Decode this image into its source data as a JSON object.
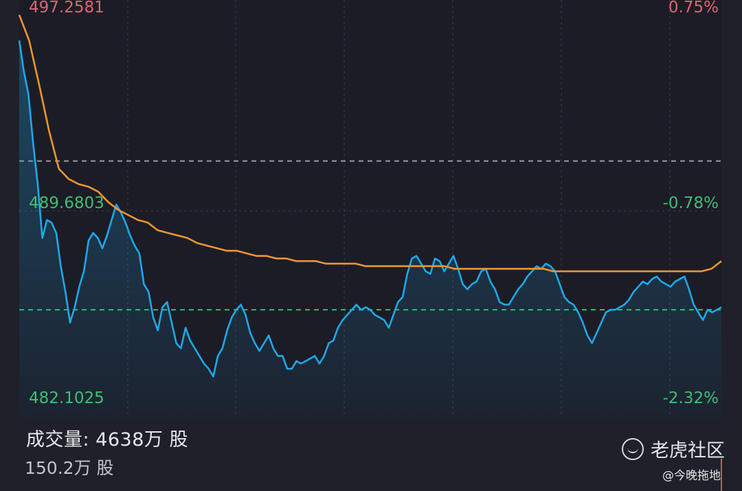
{
  "chart_data": {
    "type": "line",
    "ylim": [
      482.1025,
      497.2581
    ],
    "y_ticks_left": [
      "497.2581",
      "489.6803",
      "482.1025"
    ],
    "y_ticks_right": [
      "0.75%",
      "-0.78%",
      "-2.32%"
    ],
    "reference_prev_close_line": 491.3,
    "reference_current_line": 485.5,
    "series": [
      {
        "color": "#1fa8ea",
        "values": [
          496.0,
          494.8,
          493.9,
          492.0,
          490.4,
          488.3,
          489.0,
          488.9,
          488.5,
          487.2,
          486.2,
          485.0,
          485.6,
          486.4,
          487.0,
          488.2,
          488.5,
          488.3,
          487.9,
          488.4,
          489.0,
          489.6,
          489.3,
          488.9,
          488.4,
          488.0,
          487.7,
          486.5,
          486.2,
          485.2,
          484.7,
          485.6,
          485.8,
          485.0,
          484.2,
          484.0,
          484.8,
          484.3,
          484.0,
          483.7,
          483.4,
          483.2,
          482.9,
          483.7,
          484.0,
          484.7,
          485.2,
          485.5,
          485.7,
          485.3,
          484.6,
          484.2,
          483.9,
          484.2,
          484.5,
          484.0,
          483.7,
          483.7,
          483.2,
          483.2,
          483.5,
          483.4,
          483.5,
          483.6,
          483.7,
          483.4,
          483.7,
          484.2,
          484.3,
          484.8,
          485.1,
          485.3,
          485.5,
          485.7,
          485.5,
          485.6,
          485.5,
          485.3,
          485.2,
          485.1,
          484.8,
          485.3,
          485.8,
          486.0,
          486.9,
          487.5,
          487.6,
          487.3,
          487.0,
          486.9,
          487.5,
          487.4,
          487.0,
          487.3,
          487.6,
          487.1,
          486.5,
          486.3,
          486.5,
          486.6,
          487.0,
          487.1,
          486.6,
          486.3,
          485.8,
          485.7,
          485.7,
          486.0,
          486.3,
          486.5,
          486.8,
          487.0,
          487.2,
          487.1,
          487.3,
          487.2,
          487.0,
          486.5,
          486.0,
          485.8,
          485.7,
          485.4,
          485.0,
          484.5,
          484.2,
          484.6,
          485.0,
          485.4,
          485.5,
          485.5,
          485.6,
          485.7,
          485.9,
          486.2,
          486.4,
          486.6,
          486.5,
          486.7,
          486.8,
          486.6,
          486.5,
          486.4,
          486.6,
          486.7,
          486.8,
          486.3,
          485.7,
          485.4,
          485.1,
          485.5,
          485.4,
          485.5,
          485.6
        ]
      },
      {
        "color": "#f0952e",
        "values": [
          497.0,
          496.0,
          494.3,
          492.5,
          491.0,
          490.6,
          490.4,
          490.3,
          490.1,
          489.7,
          489.4,
          489.2,
          489.0,
          488.9,
          488.6,
          488.5,
          488.4,
          488.3,
          488.1,
          488.0,
          487.9,
          487.8,
          487.8,
          487.7,
          487.6,
          487.6,
          487.5,
          487.5,
          487.4,
          487.4,
          487.4,
          487.3,
          487.3,
          487.3,
          487.3,
          487.2,
          487.2,
          487.2,
          487.2,
          487.2,
          487.2,
          487.2,
          487.2,
          487.2,
          487.1,
          487.1,
          487.1,
          487.1,
          487.1,
          487.1,
          487.1,
          487.1,
          487.1,
          487.1,
          487.0,
          487.0,
          487.0,
          487.0,
          487.0,
          487.0,
          487.0,
          487.0,
          487.0,
          487.0,
          487.0,
          487.0,
          487.0,
          487.0,
          487.0,
          487.0,
          487.1,
          487.4
        ]
      }
    ]
  },
  "volume": {
    "label": "成交量:  4638万 股",
    "sub": "150.2万 股"
  },
  "brand": {
    "name": "老虎社区",
    "icon": "tiger-logo-icon",
    "watermark": "@今晚拖地"
  }
}
